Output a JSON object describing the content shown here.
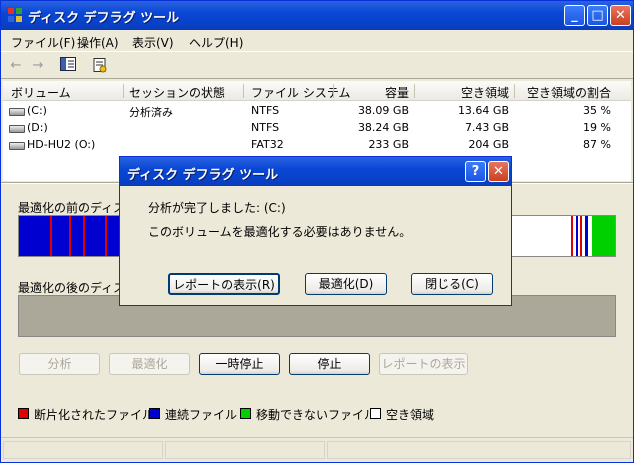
{
  "window": {
    "title": "ディスク デフラグ ツール",
    "minimize_glyph": "_",
    "maximize_glyph": "□",
    "close_glyph": "✕"
  },
  "menu": {
    "file": "ファイル(F)",
    "action": "操作(A)",
    "view": "表示(V)",
    "help": "ヘルプ(H)"
  },
  "toolbar": {
    "icons": [
      "back-arrow-icon",
      "forward-arrow-icon",
      "console-tree-icon",
      "properties-icon"
    ]
  },
  "volumes": {
    "headers": [
      "ボリューム",
      "セッションの状態",
      "ファイル システム",
      "容量",
      "空き領域",
      "空き領域の割合"
    ],
    "rows": [
      {
        "volume": "(C:)",
        "status": "分析済み",
        "fs": "NTFS",
        "capacity": "38.09 GB",
        "free": "13.64 GB",
        "pct": "35 %"
      },
      {
        "volume": "(D:)",
        "status": "",
        "fs": "NTFS",
        "capacity": "38.24 GB",
        "free": "7.43 GB",
        "pct": "19 %"
      },
      {
        "volume": "HD-HU2 (O:)",
        "status": "",
        "fs": "FAT32",
        "capacity": "233 GB",
        "free": "204 GB",
        "pct": "87 %"
      }
    ]
  },
  "analysis": {
    "before_label": "最適化の前のディスク",
    "after_label": "最適化の後のディスク"
  },
  "buttons": {
    "analyze": "分析",
    "defragment": "最適化",
    "pause": "一時停止",
    "stop": "停止",
    "view_report": "レポートの表示"
  },
  "legend": {
    "fragmented": "断片化されたファイル",
    "contiguous": "連続ファイル",
    "unmovable": "移動できないファイル",
    "free": "空き領域"
  },
  "colors": {
    "fragmented": "#e00000",
    "contiguous": "#0000d0",
    "unmovable": "#00d000",
    "free": "#ffffff",
    "titlebar": "#0a47d6"
  },
  "dialog": {
    "title": "ディスク デフラグ ツール",
    "help_glyph": "?",
    "close_glyph": "✕",
    "line1": "分析が完了しました: (C:)",
    "line2": "このボリュームを最適化する必要はありません。",
    "btn_report": "レポートの表示(R)",
    "btn_defrag": "最適化(D)",
    "btn_close": "閉じる(C)"
  }
}
